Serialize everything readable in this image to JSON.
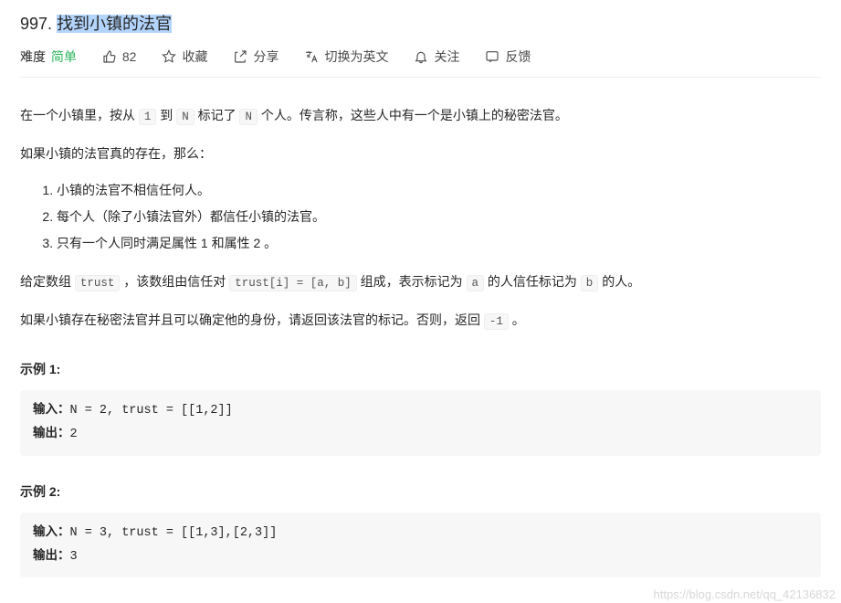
{
  "title": {
    "number": "997.",
    "text_prefix": " ",
    "text": "找到小镇的法官"
  },
  "meta": {
    "difficulty_label": "难度",
    "difficulty_value": "简单",
    "like_count": "82",
    "favorite": "收藏",
    "share": "分享",
    "switch_lang": "切换为英文",
    "follow": "关注",
    "feedback": "反馈"
  },
  "body": {
    "p1_a": "在一个小镇里，按从 ",
    "p1_b": " 到 ",
    "p1_c": " 标记了 ",
    "p1_d": " 个人。传言称，这些人中有一个是小镇上的秘密法官。",
    "p2": "如果小镇的法官真的存在，那么：",
    "li1": "小镇的法官不相信任何人。",
    "li2": "每个人（除了小镇法官外）都信任小镇的法官。",
    "li3": "只有一个人同时满足属性 1 和属性 2 。",
    "p3_a": "给定数组 ",
    "p3_b": " ，该数组由信任对 ",
    "p3_c": " 组成，表示标记为 ",
    "p3_d": " 的人信任标记为 ",
    "p3_e": " 的人。",
    "p4_a": "如果小镇存在秘密法官并且可以确定他的身份，请返回该法官的标记。否则，返回 ",
    "p4_b": " 。",
    "code1": "1",
    "codeN": "N",
    "codeN2": "N",
    "code_trust": "trust",
    "code_trust_i": "trust[i] = [a, b]",
    "code_a": "a",
    "code_b": "b",
    "code_neg1": "-1"
  },
  "examples": [
    {
      "title": "示例 1:",
      "input_label": "输入：",
      "input": "N = 2, trust = [[1,2]]",
      "output_label": "输出：",
      "output": "2"
    },
    {
      "title": "示例 2:",
      "input_label": "输入：",
      "input": "N = 3, trust = [[1,3],[2,3]]",
      "output_label": "输出：",
      "output": "3"
    }
  ],
  "watermark": "https://blog.csdn.net/qq_42136832"
}
